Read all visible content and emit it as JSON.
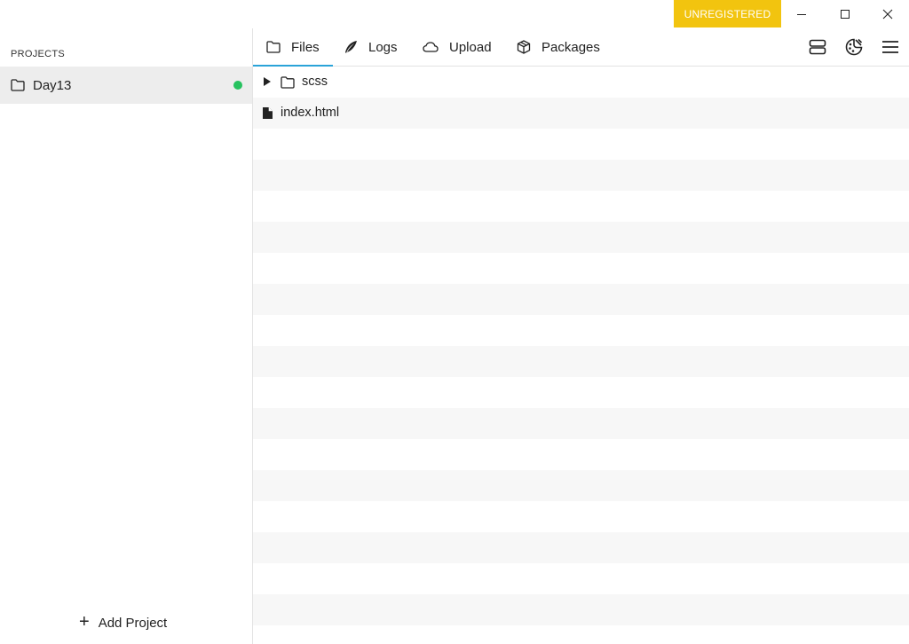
{
  "titlebar": {
    "badge": "UNREGISTERED",
    "minimize_icon": "minimize-icon",
    "maximize_icon": "maximize-icon",
    "close_icon": "close-icon"
  },
  "sidebar": {
    "heading": "PROJECTS",
    "projects": [
      {
        "name": "Day13",
        "icon": "folder-icon",
        "status": "active",
        "status_color": "#27c25f"
      }
    ],
    "add_project": "Add Project"
  },
  "tabs": [
    {
      "label": "Files",
      "icon": "folder-icon",
      "active": true
    },
    {
      "label": "Logs",
      "icon": "feather-icon",
      "active": false
    },
    {
      "label": "Upload",
      "icon": "cloud-icon",
      "active": false
    },
    {
      "label": "Packages",
      "icon": "package-icon",
      "active": false
    }
  ],
  "toolbar": {
    "icons": [
      "server-icon",
      "palette-icon",
      "menu-icon"
    ]
  },
  "files": [
    {
      "name": "scss",
      "type": "folder",
      "expanded": false
    },
    {
      "name": "index.html",
      "type": "file"
    }
  ],
  "colors": {
    "badge": "#f2c40f",
    "active_tab_underline": "#2aa3d8",
    "selected_project_bg": "#ededed"
  }
}
